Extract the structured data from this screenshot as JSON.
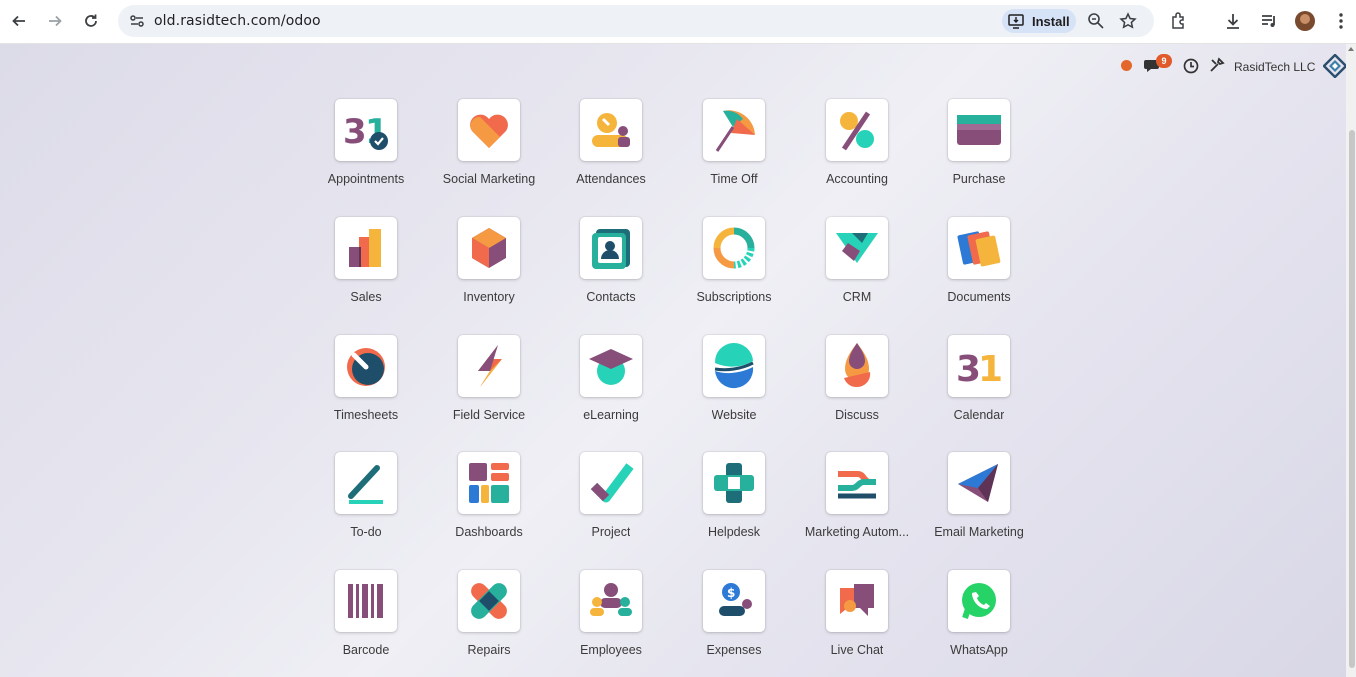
{
  "browser": {
    "url": "old.rasidtech.com/odoo",
    "install_label": "Install"
  },
  "topbar": {
    "chat_count": "9",
    "company_name": "RasidTech LLC"
  },
  "apps": [
    {
      "name": "Appointments",
      "icon": "appointments-icon"
    },
    {
      "name": "Social Marketing",
      "icon": "social-marketing-icon"
    },
    {
      "name": "Attendances",
      "icon": "attendances-icon"
    },
    {
      "name": "Time Off",
      "icon": "time-off-icon"
    },
    {
      "name": "Accounting",
      "icon": "accounting-icon"
    },
    {
      "name": "Purchase",
      "icon": "purchase-icon"
    },
    {
      "name": "Sales",
      "icon": "sales-icon"
    },
    {
      "name": "Inventory",
      "icon": "inventory-icon"
    },
    {
      "name": "Contacts",
      "icon": "contacts-icon"
    },
    {
      "name": "Subscriptions",
      "icon": "subscriptions-icon"
    },
    {
      "name": "CRM",
      "icon": "crm-icon"
    },
    {
      "name": "Documents",
      "icon": "documents-icon"
    },
    {
      "name": "Timesheets",
      "icon": "timesheets-icon"
    },
    {
      "name": "Field Service",
      "icon": "field-service-icon"
    },
    {
      "name": "eLearning",
      "icon": "elearning-icon"
    },
    {
      "name": "Website",
      "icon": "website-icon"
    },
    {
      "name": "Discuss",
      "icon": "discuss-icon"
    },
    {
      "name": "Calendar",
      "icon": "calendar-icon"
    },
    {
      "name": "To-do",
      "icon": "todo-icon"
    },
    {
      "name": "Dashboards",
      "icon": "dashboards-icon"
    },
    {
      "name": "Project",
      "icon": "project-icon"
    },
    {
      "name": "Helpdesk",
      "icon": "helpdesk-icon"
    },
    {
      "name": "Marketing Autom...",
      "icon": "marketing-automation-icon"
    },
    {
      "name": "Email Marketing",
      "icon": "email-marketing-icon"
    },
    {
      "name": "Barcode",
      "icon": "barcode-icon"
    },
    {
      "name": "Repairs",
      "icon": "repairs-icon"
    },
    {
      "name": "Employees",
      "icon": "employees-icon"
    },
    {
      "name": "Expenses",
      "icon": "expenses-icon"
    },
    {
      "name": "Live Chat",
      "icon": "live-chat-icon"
    },
    {
      "name": "WhatsApp",
      "icon": "whatsapp-icon"
    }
  ]
}
